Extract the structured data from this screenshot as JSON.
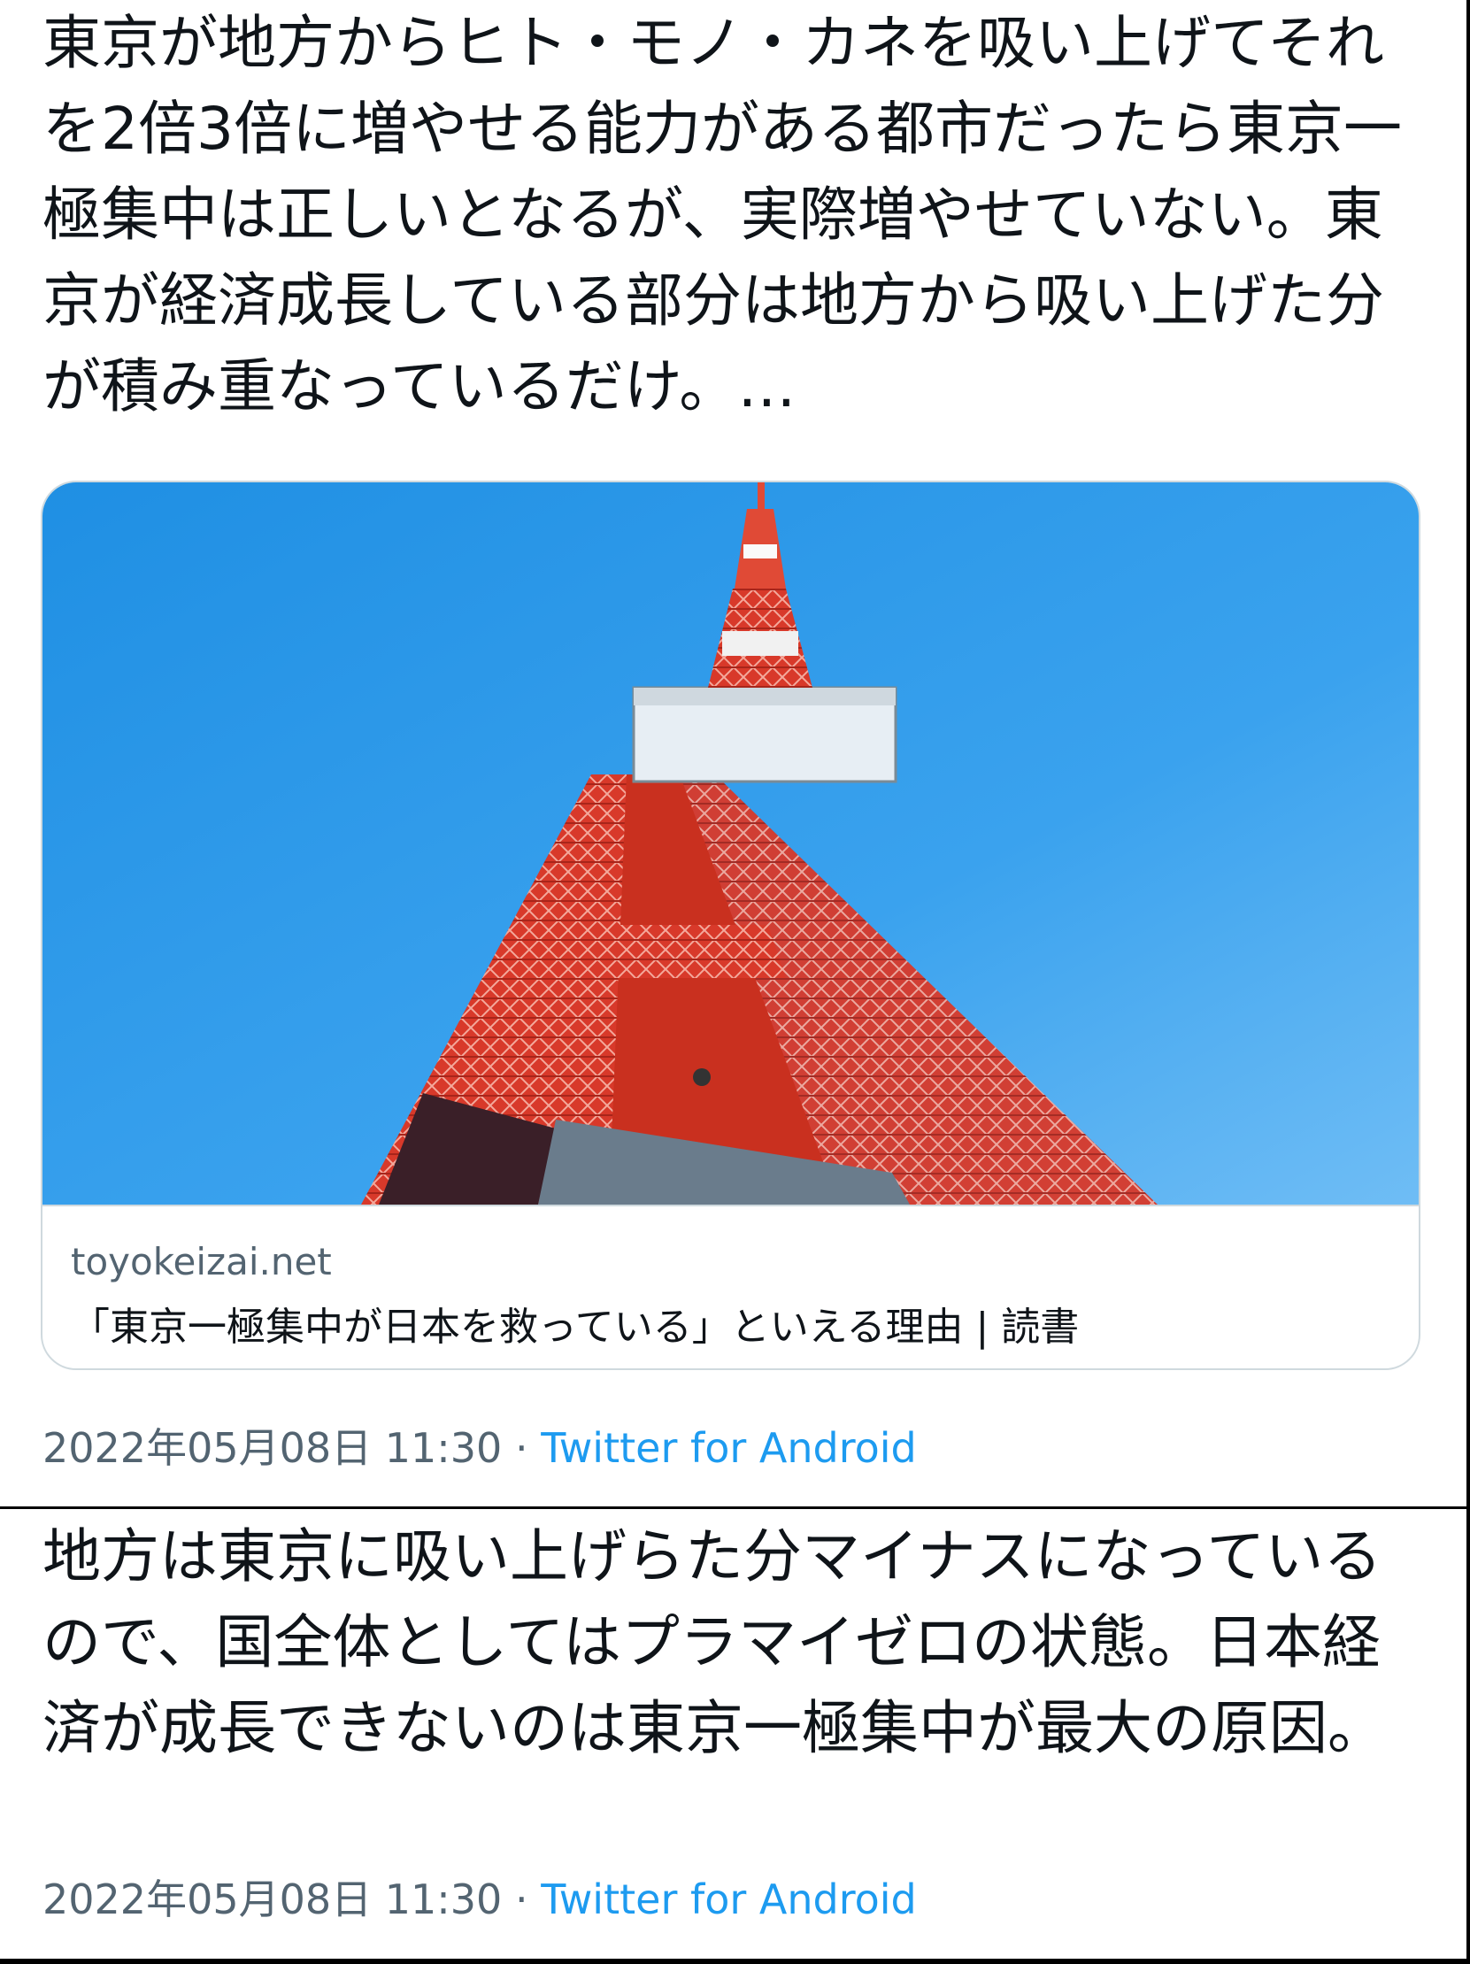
{
  "tweet1": {
    "text": "東京が地方からヒト・モノ・カネを吸い上げてそれを2倍3倍に増やせる能力がある都市だったら東京一極集中は正しいとなるが、実際増やせていない。東京が経済成長している部分は地方から吸い上げた分が積み重なっているだけ。…",
    "card": {
      "domain": "toyokeizai.net",
      "title": "「東京一極集中が日本を救っている」といえる理由 | 読書",
      "image_icon": "tokyo-tower-photo"
    },
    "date": "2022年05月08日 11:30",
    "separator": "·",
    "source": "Twitter for Android"
  },
  "tweet2": {
    "text": "地方は東京に吸い上げらた分マイナスになっているので、国全体としてはプラマイゼロの状態。日本経済が成長できないのは東京一極集中が最大の原因。",
    "date": "2022年05月08日 11:30",
    "separator": "·",
    "source": "Twitter for Android"
  },
  "colors": {
    "text": "#0f1419",
    "secondary": "#536471",
    "link": "#1d9bf0",
    "card_border": "#cfd9de",
    "sky": "#3a9be6",
    "tower_red": "#d93a2b"
  }
}
